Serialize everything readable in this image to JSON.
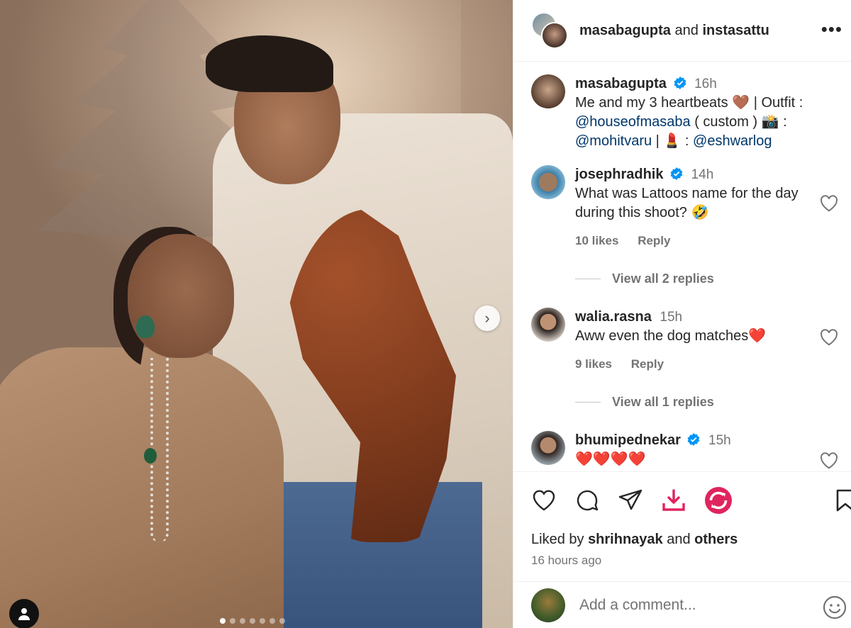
{
  "header": {
    "user1": "masabagupta",
    "conjunction": "and",
    "user2": "instasattu",
    "more_icon": "more-horizontal-icon",
    "more": "•••"
  },
  "caption": {
    "username": "masabagupta",
    "time": "16h",
    "text_1": "Me and my 3 heartbeats 🤎 | Outfit :",
    "mention_1": "@houseofmasaba",
    "text_2": " ( custom ) 📸 :",
    "mention_2": "@mohitvaru",
    "text_3": " | 💄 : ",
    "mention_3": "@eshwarlog"
  },
  "comments": [
    {
      "username": "josephradhik",
      "verified": true,
      "time": "14h",
      "text": "What was Lattoos name for the day during this shoot? 🤣",
      "likes": "10 likes",
      "reply": "Reply",
      "view_replies": "View all 2 replies"
    },
    {
      "username": "walia.rasna",
      "verified": false,
      "time": "15h",
      "text": "Aww even the dog matches❤️",
      "likes": "9 likes",
      "reply": "Reply",
      "view_replies": "View all 1 replies"
    },
    {
      "username": "bhumipednekar",
      "verified": true,
      "time": "15h",
      "text": "❤️❤️❤️❤️"
    }
  ],
  "actions": {
    "like_icon": "heart-icon",
    "comment_icon": "comment-bubble-icon",
    "share_icon": "paper-plane-icon",
    "download_icon": "download-icon",
    "extension_icon": "refresh-circle-icon",
    "save_icon": "bookmark-icon",
    "download_color": "#e0245e",
    "extension_color": "#e0245e"
  },
  "likes": {
    "prefix": "Liked by ",
    "user": "shrihnayak",
    "middle": " and ",
    "others": "others",
    "time_ago": "16 hours ago"
  },
  "comment_box": {
    "placeholder": "Add a comment...",
    "emoji_icon": "smiley-icon"
  },
  "carousel": {
    "slide": 1,
    "total": 7,
    "next_icon": "chevron-right-icon",
    "next": "›"
  },
  "colors": {
    "verified": "#0095f6",
    "link": "#00376b",
    "secondary_text": "#737373"
  }
}
